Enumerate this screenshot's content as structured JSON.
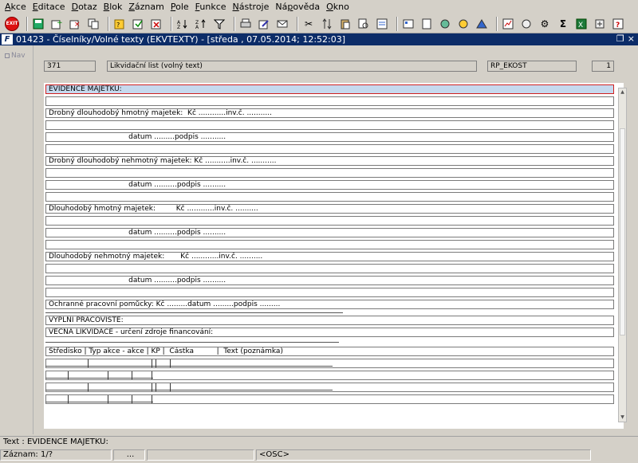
{
  "menu": [
    "Akce",
    "Editace",
    "Dotaz",
    "Blok",
    "Záznam",
    "Pole",
    "Funkce",
    "Nástroje",
    "Nápověda",
    "Okno"
  ],
  "menu_underline": [
    "A",
    "E",
    "D",
    "B",
    "Z",
    "P",
    "F",
    "N",
    "p",
    "O"
  ],
  "toolbar": {
    "exit_label": "EXIT",
    "icons": [
      "save-icon",
      "add-record-icon",
      "delete-record-icon",
      "copy-record-icon",
      "query-icon",
      "execute-query-icon",
      "cancel-query-icon",
      "sort-icon",
      "filter-icon",
      "print-icon",
      "edit-icon",
      "mail-icon",
      "cut-icon",
      "copy-icon",
      "paste-icon",
      "find-icon",
      "help-context-icon",
      "refresh-icon",
      "calendar-icon",
      "document-icon",
      "globe-icon",
      "chart-icon",
      "sum-icon",
      "excel-icon",
      "settings-icon",
      "help-icon"
    ]
  },
  "window": {
    "logo": "F",
    "title": "01423 - Číselníky/Volné texty (EKVTEXTY) - [středa , 07.05.2014; 12:52:03]",
    "restore": "❐",
    "close": "×"
  },
  "nav": {
    "label": "Nav"
  },
  "header_fields": {
    "code": "371",
    "name": "Likvidační list (volný text)",
    "report": "RP_EKOST",
    "number": "1"
  },
  "rows": [
    "EVIDENCE MAJETKU:",
    "",
    "Drobný dlouhodobý hmotný majetek:  Kč ............inv.č. ...........",
    "",
    "                                   datum .........podpis ...........",
    "",
    "Drobný dlouhodobý nehmotný majetek: Kč ...........inv.č. ...........",
    "",
    "                                   datum ..........podpis ..........",
    "",
    "Dlouhodobý hmotný majetek:         Kč ............inv.č. ..........",
    "",
    "                                   datum ..........podpis ..........",
    "",
    "Dlouhodobý nehmotný majetek:       Kč ............inv.č. ..........",
    "",
    "                                   datum ..........podpis ..........",
    "",
    "Ochranné pracovní pomůcky: Kč .........datum .........podpis ........."
  ],
  "lower_rows": {
    "vyplni": "VYPLNÍ PRACOVIŠTĚ:",
    "vecna": "VĚCNÁ LIKVIDACE - určení zdroje financování:",
    "header": "Středisko | Typ akce - akce | KP |  Částka          |  Text (poznámka)"
  },
  "status": {
    "line1": "Text :  EVIDENCE MAJETKU:",
    "record": "Záznam: 1/?",
    "ellipsis1": "...",
    "osc": "<OSC>"
  }
}
